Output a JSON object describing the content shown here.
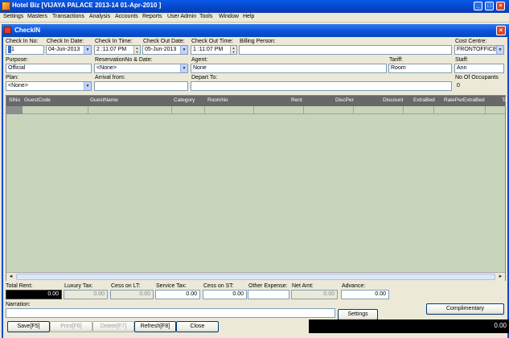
{
  "app": {
    "title": "Hotel Biz  [VIJAYA PALACE 2013-14 01-Apr-2010 ]",
    "window_buttons": {
      "minimize": "_",
      "maximize": "□",
      "close": "×"
    }
  },
  "menu": [
    "Settings",
    "Masters",
    "Transactions",
    "Analysis",
    "Accounts",
    "Reports",
    "User Admin",
    "Tools",
    "Window",
    "Help"
  ],
  "child_window": {
    "title": "CheckIN",
    "close": "×"
  },
  "form": {
    "check_in_no": {
      "label": "Check In No:",
      "value": "1"
    },
    "check_in_date": {
      "label": "Check In Date:",
      "value": "04-Jun-2013"
    },
    "check_in_time": {
      "label": "Check In Time:",
      "value": "2 :11:07 PM"
    },
    "check_out_date": {
      "label": "Check Out Date:",
      "value": "05-Jun-2013"
    },
    "check_out_time": {
      "label": "Check Out Time:",
      "value": "1 :11:07 PM"
    },
    "billing_person": {
      "label": "Billing Person:",
      "value": ""
    },
    "cost_centre": {
      "label": "Cost Centre:",
      "value": "FRONTOFFICE"
    },
    "purpose": {
      "label": "Purpose:",
      "value": "Official"
    },
    "reservation": {
      "label": "ReservationNo & Date:",
      "value": "<None>"
    },
    "agent": {
      "label": "Agent:",
      "value": "None"
    },
    "tariff": {
      "label": "Tariff:",
      "value": "Room"
    },
    "staff": {
      "label": "Staff:",
      "value": "Ann"
    },
    "plan": {
      "label": "Plan:",
      "value": "<None>"
    },
    "arrival_from": {
      "label": "Arrival from:",
      "value": ""
    },
    "depart_to": {
      "label": "Depart To:",
      "value": ""
    },
    "occupants": {
      "label": "No Of Occupants",
      "value": "0"
    }
  },
  "grid": {
    "columns": [
      "SlNo",
      "GuestCode",
      "GuestName",
      "Category",
      "RoomNo",
      "Rent",
      "DiscPer",
      "Discount",
      "ExtraBed",
      "RatePerExtraBed",
      "Ta"
    ]
  },
  "totals": {
    "total_rent": {
      "label": "Total Rent:",
      "value": "0.00"
    },
    "luxury_tax": {
      "label": "Luxury Tax:",
      "value": "0.00"
    },
    "cess_on_lt": {
      "label": "Cess on LT:",
      "value": "0.00"
    },
    "service_tax": {
      "label": "Service Tax:",
      "value": "0.00"
    },
    "cess_on_st": {
      "label": "Cess on ST:",
      "value": "0.00"
    },
    "other_expense": {
      "label": "Other Expense:",
      "value": ""
    },
    "net_amt": {
      "label": "Net Amt:",
      "value": "0.00"
    },
    "advance": {
      "label": "Advance:",
      "value": "0.00"
    }
  },
  "narration": {
    "label": "Narration:",
    "value": ""
  },
  "buttons": {
    "complimentary": "Complimentary",
    "settings": "Settings",
    "save": "Save[F5]",
    "print": "Print[F6]",
    "delete": "Delete[F7]",
    "refresh": "Refresh[F8]",
    "close": "Close"
  },
  "status_value": "0.00",
  "icons": {
    "dropdown": "▼",
    "spin_up": "▲",
    "spin_down": "▼",
    "scroll_left": "◄",
    "scroll_right": "►"
  }
}
